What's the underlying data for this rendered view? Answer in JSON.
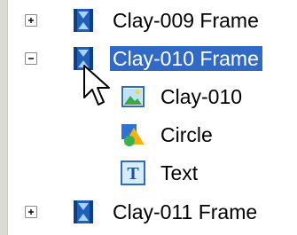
{
  "tree": {
    "items": [
      {
        "label": "Clay-009 Frame",
        "icon": "frame-icon",
        "expander": "plus",
        "selected": false
      },
      {
        "label": "Clay-010 Frame",
        "icon": "frame-icon",
        "expander": "minus",
        "selected": true
      },
      {
        "label": "Clay-010",
        "icon": "image-icon"
      },
      {
        "label": "Circle",
        "icon": "shape-icon"
      },
      {
        "label": "Text",
        "icon": "text-icon"
      },
      {
        "label": "Clay-011 Frame",
        "icon": "frame-icon",
        "expander": "plus",
        "selected": false
      }
    ],
    "text_icon_glyph": "T"
  },
  "colors": {
    "selection": "#316ac5",
    "frame_icon_blue": "#1f5fb8"
  }
}
